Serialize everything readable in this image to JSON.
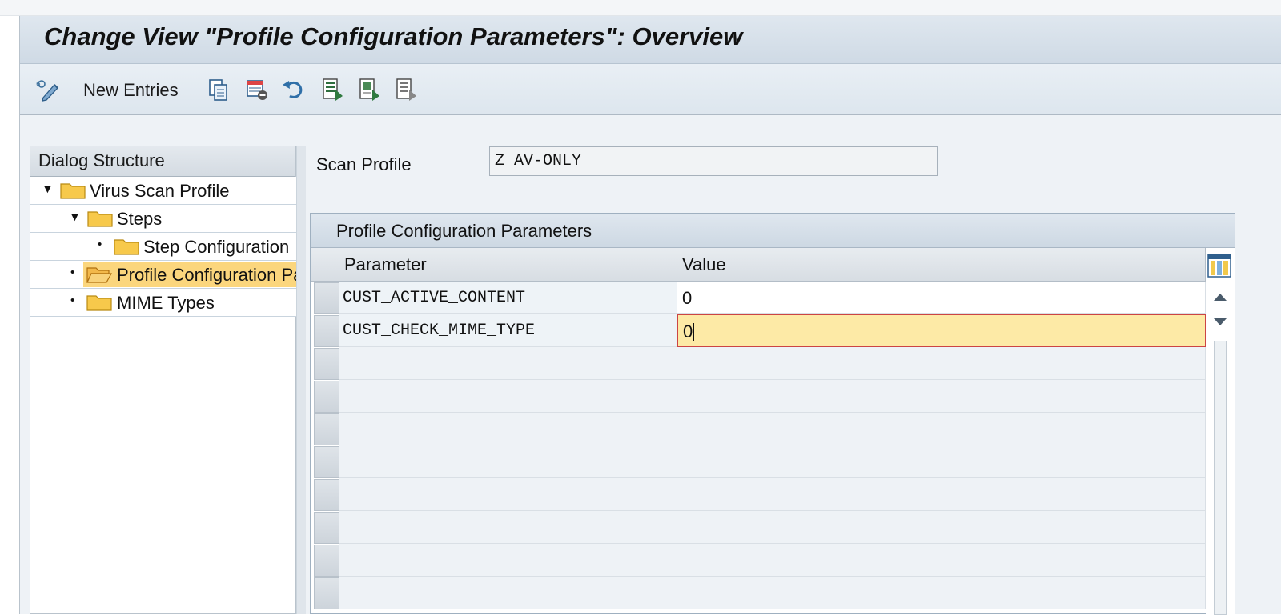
{
  "window": {
    "title": "Change View \"Profile Configuration Parameters\": Overview"
  },
  "toolbar": {
    "new_entries_label": "New Entries",
    "icons": [
      "display-change-icon",
      "copy-icon",
      "delete-icon",
      "undo-icon",
      "select-all-icon",
      "select-block-icon",
      "deselect-all-icon"
    ]
  },
  "dialog_structure": {
    "header": "Dialog Structure",
    "items": [
      {
        "label": "Virus Scan Profile",
        "expander": "expanded",
        "selected": false
      },
      {
        "label": "Steps",
        "expander": "expanded",
        "selected": false
      },
      {
        "label": "Step Configuration",
        "expander": "leaf",
        "selected": false
      },
      {
        "label": "Profile Configuration Parameters",
        "expander": "leaf",
        "selected": true
      },
      {
        "label": "MIME Types",
        "expander": "leaf",
        "selected": false
      }
    ]
  },
  "scan_profile": {
    "label": "Scan Profile",
    "value": "Z_AV-ONLY"
  },
  "table": {
    "title": "Profile Configuration Parameters",
    "columns": [
      "Parameter",
      "Value"
    ],
    "rows": [
      {
        "parameter": "CUST_ACTIVE_CONTENT",
        "value": "0"
      },
      {
        "parameter": "CUST_CHECK_MIME_TYPE",
        "value": "0"
      }
    ],
    "active_row": 1
  },
  "colors": {
    "selection_highlight": "#fbd67d",
    "active_cell": "#fdeaa6",
    "header_blue": "#d4dee8"
  }
}
